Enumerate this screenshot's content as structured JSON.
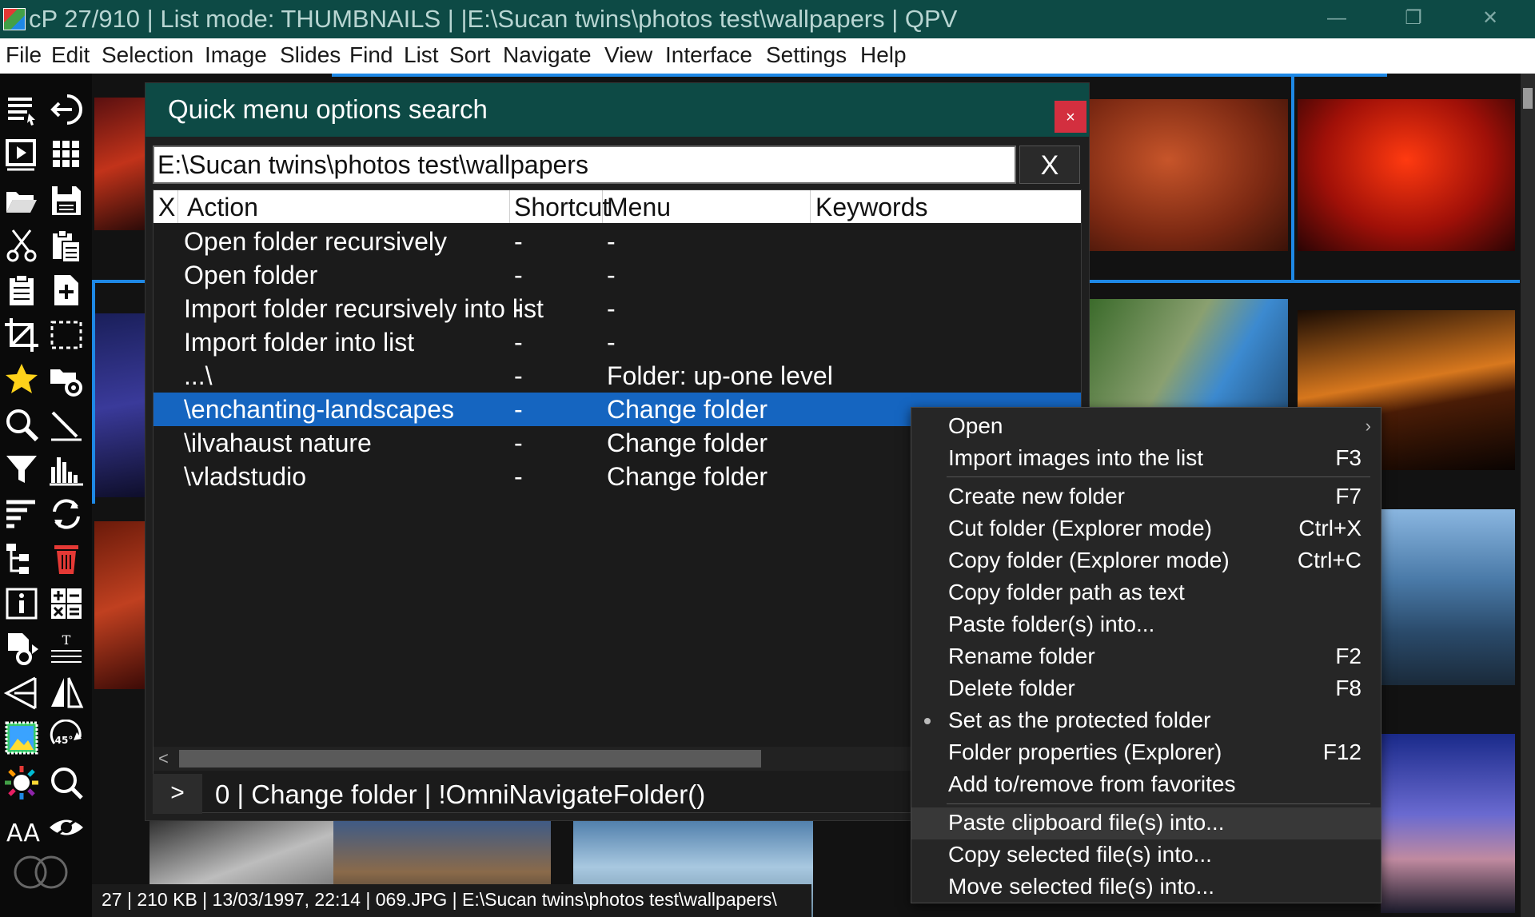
{
  "window": {
    "title": "cP 27/910 | List mode: THUMBNAILS | |E:\\Sucan twins\\photos test\\wallpapers | QPV",
    "minimize_glyph": "—",
    "maximize_glyph": "❐",
    "close_glyph": "✕"
  },
  "menubar": {
    "items": [
      "File",
      "Edit",
      "Selection",
      "Image",
      "Slides",
      "Find",
      "List",
      "Sort",
      "Navigate",
      "View",
      "Interface",
      "Settings",
      "Help"
    ]
  },
  "toolbar": {
    "icons": [
      "list-settings-icon",
      "exit-icon",
      "slideshow-icon",
      "grid-icon",
      "open-folder-icon",
      "save-icon",
      "cut-icon",
      "paste-icon",
      "clipboard-icon",
      "new-image-icon",
      "crop-icon",
      "selection-rect-icon",
      "favorite-star-icon",
      "folder-settings-icon",
      "zoom-tool-icon",
      "pen-tool-icon",
      "filter-icon",
      "histogram-icon",
      "list-sort-icon",
      "refresh-icon",
      "tree-view-icon",
      "delete-icon",
      "info-icon",
      "calculator-icon",
      "file-convert-icon",
      "text-tool-icon",
      "resize-icon",
      "flip-icon",
      "color-adjust-icon",
      "rotate-45-icon",
      "brightness-icon",
      "zoom-icon",
      "font-size-icon",
      "eye-icon",
      "compare-circles-icon"
    ],
    "rotate_label": "45°",
    "font_label": "AA"
  },
  "dialog": {
    "title": "Quick menu options search",
    "close_glyph": "×",
    "search_value": "E:\\Sucan twins\\photos test\\wallpapers",
    "clear_label": "X",
    "columns": [
      "X",
      "Action",
      "Shortcut",
      "Menu",
      "Keywords"
    ],
    "rows": [
      {
        "action": "Open folder recursively",
        "shortcut": "-",
        "menu": "-"
      },
      {
        "action": "Open folder",
        "shortcut": "-",
        "menu": "-"
      },
      {
        "action": "Import folder recursively into list",
        "shortcut": "-",
        "menu": "-"
      },
      {
        "action": "Import folder into list",
        "shortcut": "-",
        "menu": "-"
      },
      {
        "action": "...\\",
        "shortcut": "-",
        "menu": "Folder: up-one level"
      },
      {
        "action": "\\enchanting-landscapes",
        "shortcut": "-",
        "menu": "Change folder"
      },
      {
        "action": "\\ilvahaust nature",
        "shortcut": "-",
        "menu": "Change folder"
      },
      {
        "action": "\\vladstudio",
        "shortcut": "-",
        "menu": "Change folder"
      }
    ],
    "selected_row": 5,
    "scroll_arrow": "<",
    "command_button": ">",
    "command_text": "0 | Change folder | !OmniNavigateFolder()"
  },
  "context_menu": {
    "items": [
      {
        "label": "Open",
        "shortcut": "",
        "submenu": true
      },
      {
        "label": "Import images into the list",
        "shortcut": "F3"
      },
      {
        "label": "Create new folder",
        "shortcut": "F7"
      },
      {
        "label": "Cut folder (Explorer mode)",
        "shortcut": "Ctrl+X"
      },
      {
        "label": "Copy folder (Explorer mode)",
        "shortcut": "Ctrl+C"
      },
      {
        "label": "Copy folder path as text",
        "shortcut": ""
      },
      {
        "label": "Paste folder(s) into...",
        "shortcut": ""
      },
      {
        "label": "Rename folder",
        "shortcut": "F2"
      },
      {
        "label": "Delete folder",
        "shortcut": "F8"
      },
      {
        "label": "Set as the protected folder",
        "shortcut": "",
        "dot": true
      },
      {
        "label": "Folder properties (Explorer)",
        "shortcut": "F12"
      },
      {
        "label": "Add to/remove from favorites",
        "shortcut": ""
      },
      {
        "label": "Paste clipboard file(s) into...",
        "shortcut": "",
        "highlighted": true
      },
      {
        "label": "Copy selected file(s) into...",
        "shortcut": ""
      },
      {
        "label": "Move selected file(s) into...",
        "shortcut": ""
      }
    ],
    "submenu_glyph": "›"
  },
  "statusbar": {
    "text": "27 | 210 KB | 13/03/1997, 22:14 | 069.JPG | E:\\Sucan twins\\photos test\\wallpapers\\"
  },
  "colors": {
    "titlebar": "#0d4a45",
    "accent_blue": "#1e88e5",
    "selection": "#1565c0",
    "close_red": "#d32f3f"
  }
}
